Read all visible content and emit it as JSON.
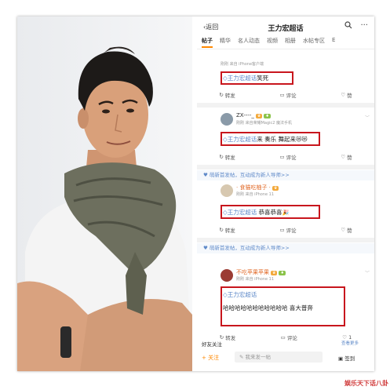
{
  "app": {
    "back_label": "返回",
    "title": "王力宏超话",
    "search_icon": "search-icon",
    "more_icon": "more-icon"
  },
  "tabs": [
    "帖子",
    "精华",
    "名人动态",
    "视频",
    "相册",
    "水帖专区",
    "E"
  ],
  "colors": {
    "highlight_border": "#c8161d",
    "accent": "#ff8200",
    "link": "#5f8ac9"
  },
  "posts": [
    {
      "meta": "刚刚 来自 iPhone客户端",
      "tag": "王力宏超话",
      "text": "笑死",
      "repost": "转发",
      "comment": "评论",
      "like": "赞"
    },
    {
      "username": "ZX----_",
      "meta": "刚刚 来自荣耀Magic2 魔法手机",
      "tag": "王力宏超话",
      "text": "来 奏乐 舞起来",
      "repost": "转发",
      "comment": "评论",
      "like": "赞"
    },
    {
      "notice": "萌新首发帖，互动成为新人导师>>",
      "username": "· 食猫吃柚子 ·",
      "meta": "刚刚 来自 iPhone 11",
      "tag": "王力宏超话",
      "text": "恭喜恭喜",
      "repost": "转发",
      "comment": "评论",
      "like": "赞"
    },
    {
      "notice": "萌新首发帖，互动成为新人导师>>",
      "username": "不吃苹果苹果",
      "meta": "刚刚 来自 iPhone 11",
      "tag": "王力宏超话",
      "text": "哈哈哈哈哈哈哈哈哈哈哈  喜大普奔",
      "repost": "转发",
      "comment": "评论",
      "like": "1"
    }
  ],
  "footer": {
    "friends": "好友关注",
    "more": "查看更多",
    "follow": "关注",
    "input_placeholder": "我来发一帖",
    "checkin": "签到"
  },
  "watermark": "娱乐天下话八卦"
}
